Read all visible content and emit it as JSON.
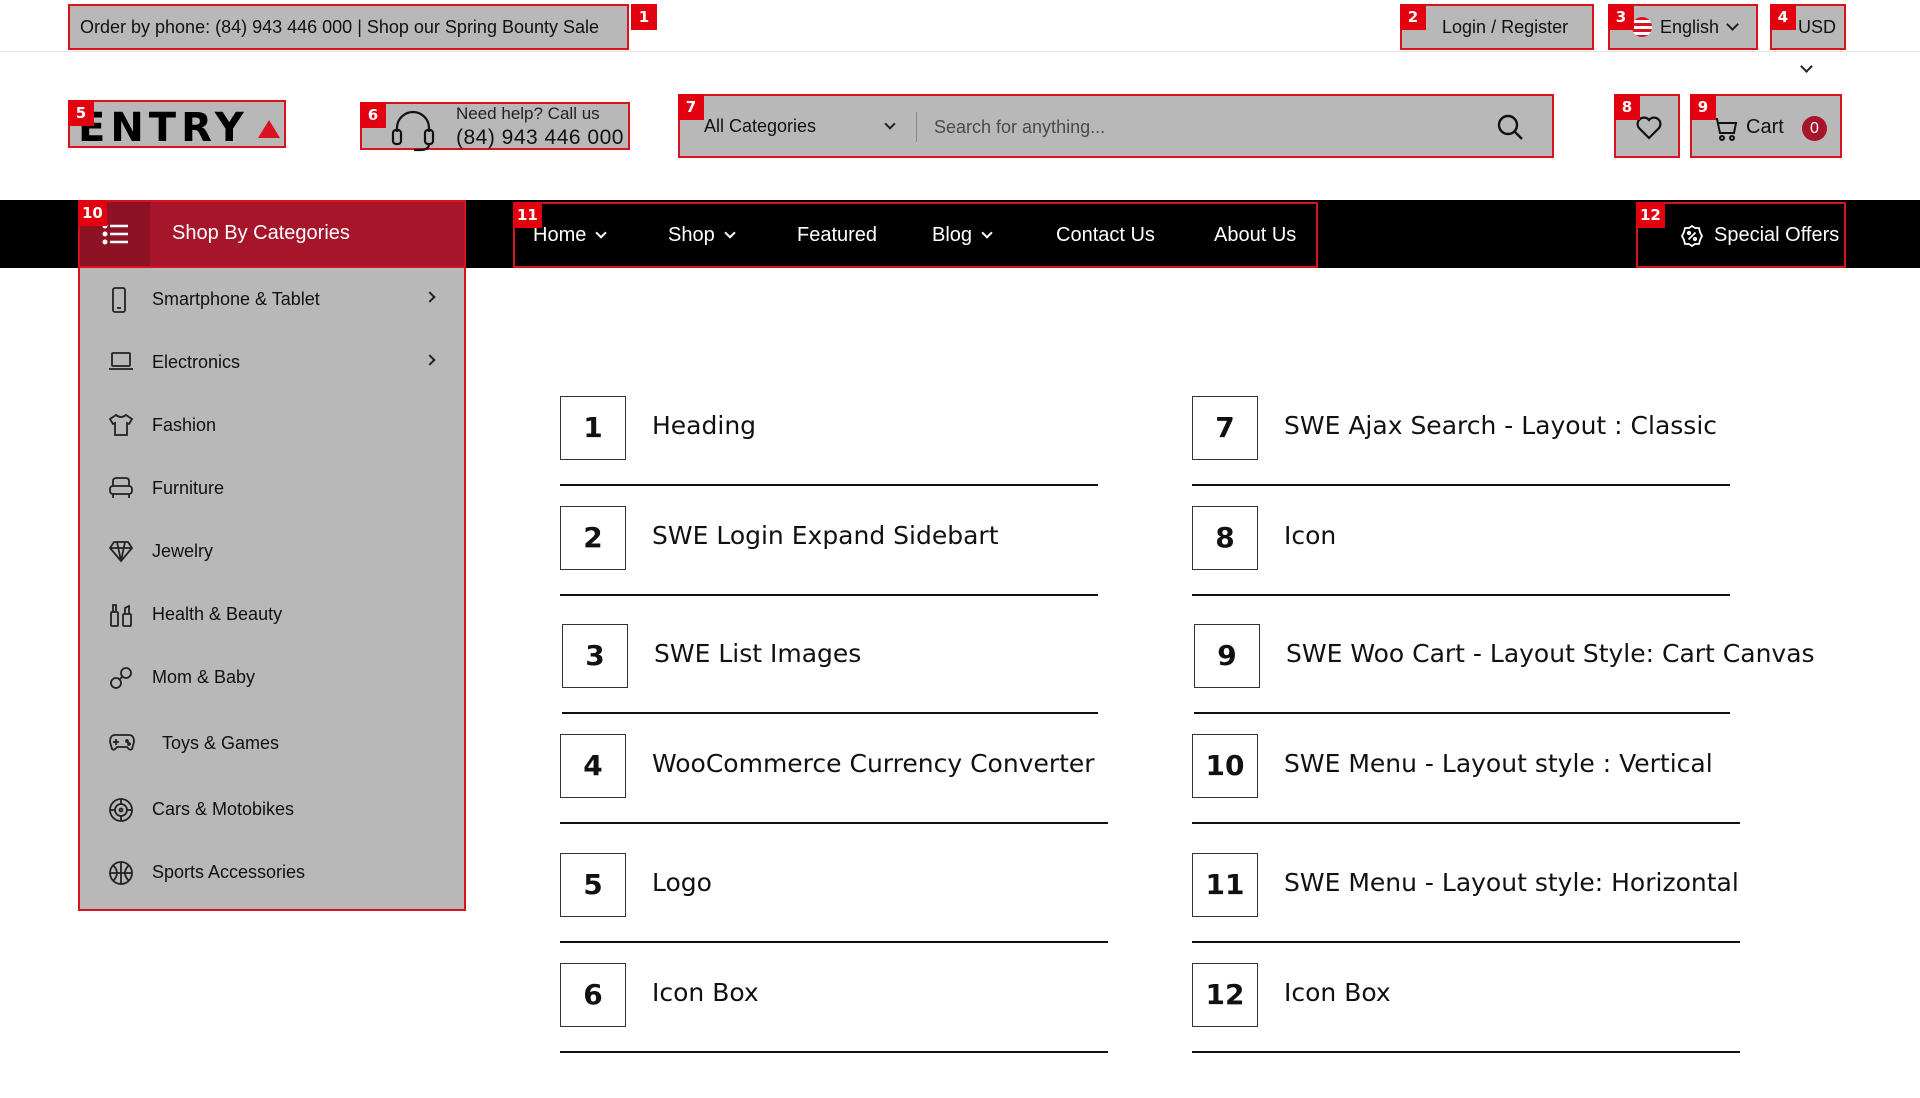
{
  "topbar": {
    "promo": "Order by phone: (84) 943 446 000 | Shop our Spring Bounty Sale",
    "login": "Login",
    "register": "/ Register",
    "language": "English",
    "currency": "USD"
  },
  "header": {
    "logo_text": "ENTRY",
    "help_line1": "Need help? Call us",
    "help_phone": "(84) 943 446 000",
    "category_select": "All Categories",
    "search_placeholder": "Search for anything...",
    "cart_label": "Cart",
    "cart_count": "0"
  },
  "nav": {
    "categories_label": "Shop By Categories",
    "items": [
      {
        "label": "Home",
        "dropdown": true
      },
      {
        "label": "Shop",
        "dropdown": true
      },
      {
        "label": "Featured",
        "dropdown": false
      },
      {
        "label": "Blog",
        "dropdown": true
      },
      {
        "label": "Contact Us",
        "dropdown": false
      },
      {
        "label": "About Us",
        "dropdown": false
      }
    ],
    "special_offers": "Special Offers"
  },
  "sidebar": {
    "items": [
      {
        "label": "Smartphone & Tablet",
        "icon": "smartphone-icon",
        "submenu": true
      },
      {
        "label": "Electronics",
        "icon": "laptop-icon",
        "submenu": true
      },
      {
        "label": "Fashion",
        "icon": "shirt-icon",
        "submenu": false
      },
      {
        "label": "Furniture",
        "icon": "armchair-icon",
        "submenu": false
      },
      {
        "label": "Jewelry",
        "icon": "diamond-icon",
        "submenu": false
      },
      {
        "label": "Health & Beauty",
        "icon": "cosmetics-icon",
        "submenu": false
      },
      {
        "label": "Mom & Baby",
        "icon": "pacifier-icon",
        "submenu": false
      },
      {
        "label": "Toys & Games",
        "icon": "gamepad-icon",
        "submenu": false
      },
      {
        "label": "Cars & Motobikes",
        "icon": "wheel-icon",
        "submenu": false
      },
      {
        "label": "Sports Accessories",
        "icon": "ball-icon",
        "submenu": false
      }
    ]
  },
  "markers": [
    "1",
    "2",
    "3",
    "4",
    "5",
    "6",
    "7",
    "8",
    "9",
    "10",
    "11",
    "12"
  ],
  "legend": [
    {
      "num": "1",
      "label": "Heading"
    },
    {
      "num": "2",
      "label": "SWE Login Expand Sidebart"
    },
    {
      "num": "3",
      "label": "SWE List Images"
    },
    {
      "num": "4",
      "label": "WooCommerce Currency Converter"
    },
    {
      "num": "5",
      "label": "Logo"
    },
    {
      "num": "6",
      "label": "Icon Box"
    },
    {
      "num": "7",
      "label": "SWE Ajax Search - Layout : Classic"
    },
    {
      "num": "8",
      "label": "Icon"
    },
    {
      "num": "9",
      "label": "SWE Woo Cart - Layout Style: Cart Canvas"
    },
    {
      "num": "10",
      "label": "SWE Menu - Layout style : Vertical"
    },
    {
      "num": "11",
      "label": "SWE Menu - Layout style: Horizontal"
    },
    {
      "num": "12",
      "label": "Icon Box"
    }
  ],
  "colors": {
    "accent": "#a6152a",
    "highlight": "#d8121f",
    "marker": "#e3000f",
    "nav_bg": "#000000"
  }
}
